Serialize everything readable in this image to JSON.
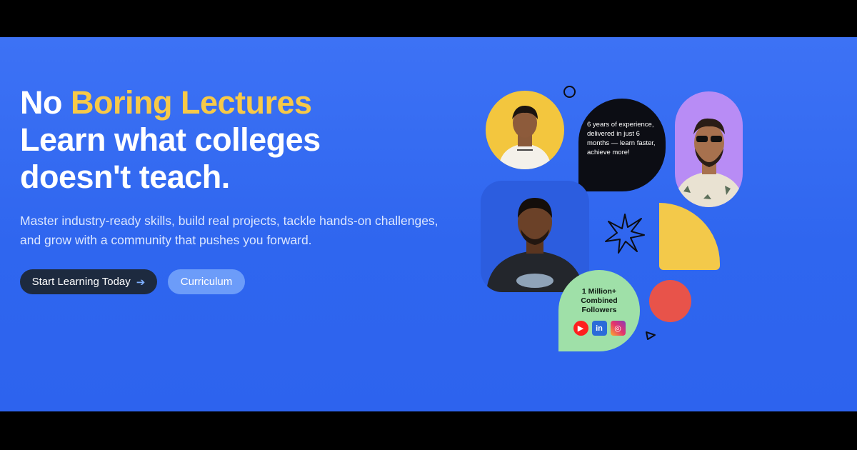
{
  "hero": {
    "headline_prefix": "No ",
    "headline_highlight": "Boring Lectures",
    "headline_line2": "Learn what colleges",
    "headline_line3": "doesn't teach.",
    "subtitle_line1": "Master industry-ready skills, build real projects, tackle hands-on challenges,",
    "subtitle_line2": "and grow with a community that pushes you forward.",
    "primary_button": "Start Learning Today",
    "secondary_button": "Curriculum"
  },
  "collage": {
    "bubble_text": "6 years of experience, delivered in just 6 months — learn faster, achieve more!",
    "stat_line1": "1 Million+",
    "stat_line2": "Combined",
    "stat_line3": "Followers",
    "social_icons": [
      "youtube-icon",
      "linkedin-icon",
      "instagram-icon"
    ]
  },
  "colors": {
    "background": "#2f66ef",
    "highlight": "#f7c948",
    "primary_button": "#1d2a3f",
    "secondary_button": "#6c9cf9",
    "green_card": "#9fe0a8",
    "yellow_shape": "#f3c94a",
    "red_circle": "#e8534a",
    "purple_frame": "#b88cf5"
  }
}
